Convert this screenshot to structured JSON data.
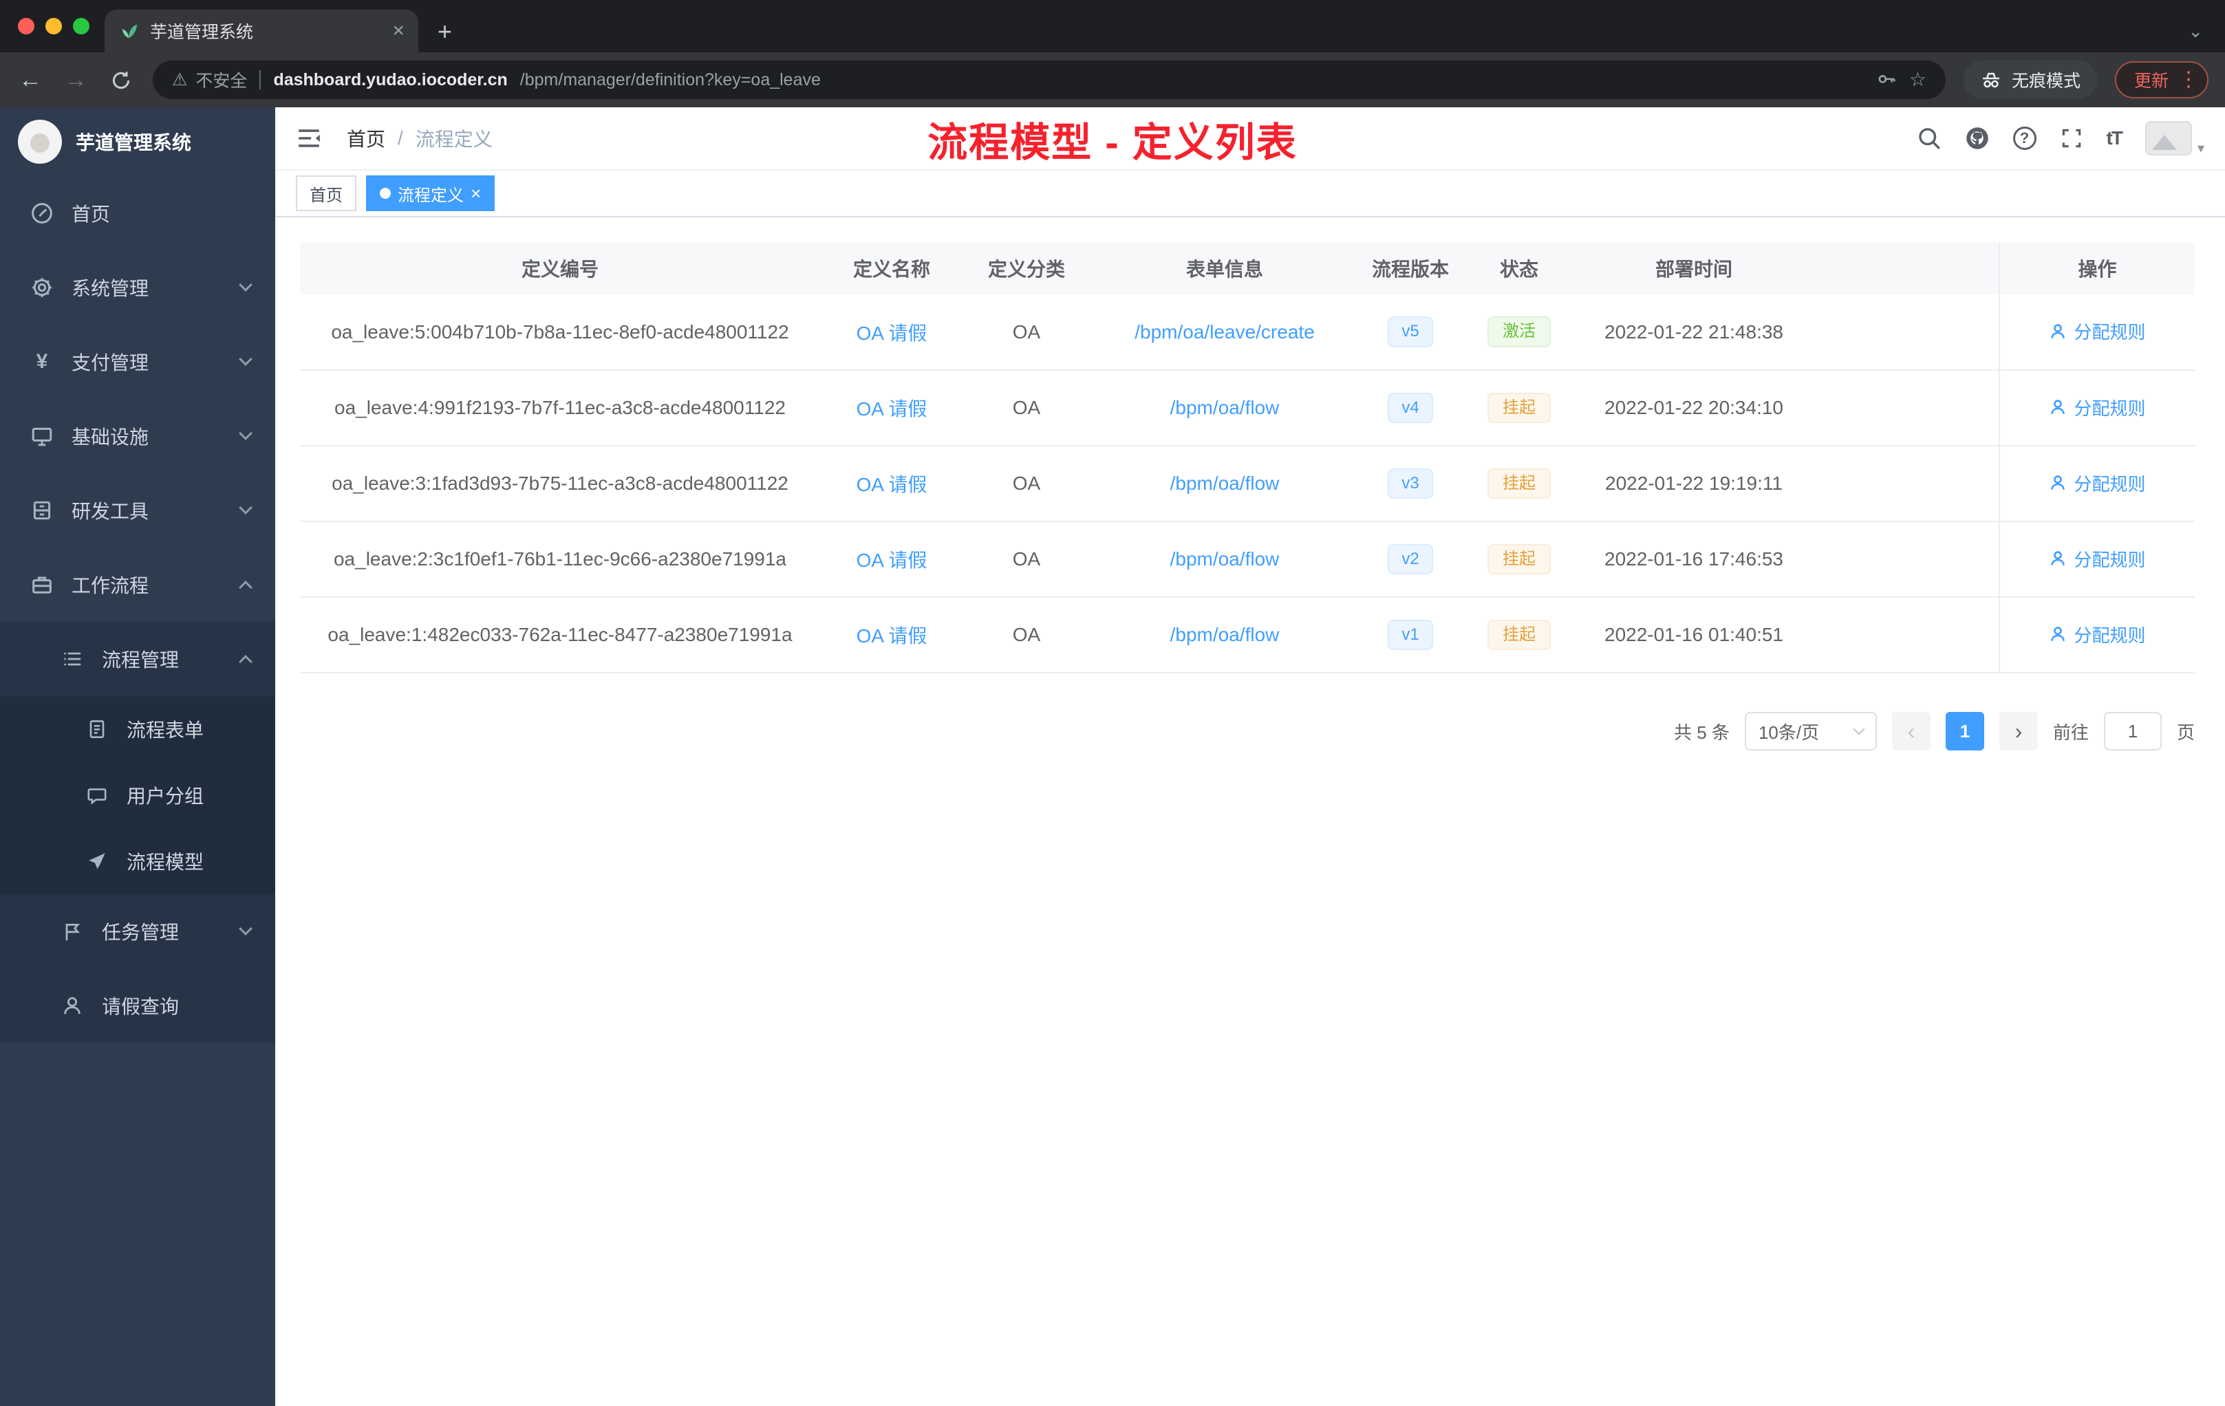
{
  "colors": {
    "accent": "#409eff",
    "annotation_red": "#f5222d",
    "status_success": "#67c23a",
    "status_warning": "#e6a23c",
    "sidebar_bg": "#2f3c50"
  },
  "icons": {
    "close": "×",
    "plus": "+",
    "back": "←",
    "forward": "→",
    "warning": "⚠",
    "star": "☆",
    "more_vertical": "⋮",
    "tab_chevron": "⌄",
    "breadcrumb_sep": "/",
    "question": "?",
    "font_size": "tT",
    "caret_down": "▾",
    "prev": "‹",
    "next": "›",
    "yen": "¥"
  },
  "browser": {
    "tab_title": "芋道管理系统",
    "security_label": "不安全",
    "url_host": "dashboard.yudao.iocoder.cn",
    "url_path": "/bpm/manager/definition?key=oa_leave",
    "incognito_label": "无痕模式",
    "update_label": "更新"
  },
  "sidebar": {
    "logo_title": "芋道管理系统",
    "items": [
      {
        "label": "首页"
      },
      {
        "label": "系统管理"
      },
      {
        "label": "支付管理"
      },
      {
        "label": "基础设施"
      },
      {
        "label": "研发工具"
      },
      {
        "label": "工作流程"
      }
    ],
    "workflow": {
      "process_mgmt": {
        "label": "流程管理",
        "children": [
          {
            "label": "流程表单"
          },
          {
            "label": "用户分组"
          },
          {
            "label": "流程模型"
          }
        ]
      },
      "task_mgmt": {
        "label": "任务管理"
      },
      "leave_query": {
        "label": "请假查询"
      }
    }
  },
  "header": {
    "breadcrumb": [
      "首页",
      "流程定义"
    ],
    "annotation": "流程模型 - 定义列表"
  },
  "tags": {
    "items": [
      {
        "label": "首页"
      },
      {
        "label": "流程定义"
      }
    ]
  },
  "table": {
    "headers": [
      "定义编号",
      "定义名称",
      "定义分类",
      "表单信息",
      "流程版本",
      "状态",
      "部署时间",
      "操作"
    ],
    "rows": [
      {
        "id": "oa_leave:5:004b710b-7b8a-11ec-8ef0-acde48001122",
        "name": "OA 请假",
        "category": "OA",
        "form": "/bpm/oa/leave/create",
        "version": "v5",
        "status": "激活",
        "status_type": "success",
        "time": "2022-01-22 21:48:38",
        "action": "分配规则"
      },
      {
        "id": "oa_leave:4:991f2193-7b7f-11ec-a3c8-acde48001122",
        "name": "OA 请假",
        "category": "OA",
        "form": "/bpm/oa/flow",
        "version": "v4",
        "status": "挂起",
        "status_type": "warning",
        "time": "2022-01-22 20:34:10",
        "action": "分配规则"
      },
      {
        "id": "oa_leave:3:1fad3d93-7b75-11ec-a3c8-acde48001122",
        "name": "OA 请假",
        "category": "OA",
        "form": "/bpm/oa/flow",
        "version": "v3",
        "status": "挂起",
        "status_type": "warning",
        "time": "2022-01-22 19:19:11",
        "action": "分配规则"
      },
      {
        "id": "oa_leave:2:3c1f0ef1-76b1-11ec-9c66-a2380e71991a",
        "name": "OA 请假",
        "category": "OA",
        "form": "/bpm/oa/flow",
        "version": "v2",
        "status": "挂起",
        "status_type": "warning",
        "time": "2022-01-16 17:46:53",
        "action": "分配规则"
      },
      {
        "id": "oa_leave:1:482ec033-762a-11ec-8477-a2380e71991a",
        "name": "OA 请假",
        "category": "OA",
        "form": "/bpm/oa/flow",
        "version": "v1",
        "status": "挂起",
        "status_type": "warning",
        "time": "2022-01-16 01:40:51",
        "action": "分配规则"
      }
    ]
  },
  "pagination": {
    "total": "共 5 条",
    "page_size": "10条/页",
    "current": "1",
    "goto_label": "前往",
    "goto_value": "1",
    "unit_label": "页"
  }
}
